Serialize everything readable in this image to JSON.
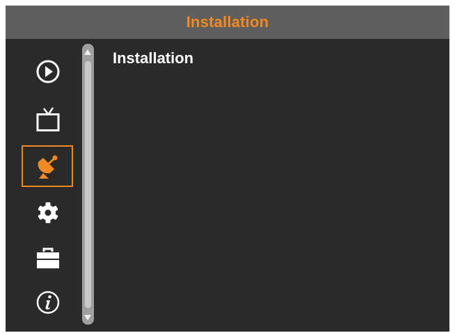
{
  "header": {
    "title": "Installation"
  },
  "content": {
    "title": "Installation"
  },
  "sidebar": {
    "items": [
      {
        "icon": "play-circle-icon",
        "selected": false
      },
      {
        "icon": "tv-icon",
        "selected": false
      },
      {
        "icon": "satellite-dish-icon",
        "selected": true
      },
      {
        "icon": "gear-icon",
        "selected": false
      },
      {
        "icon": "toolbox-icon",
        "selected": false
      },
      {
        "icon": "info-icon",
        "selected": false
      }
    ]
  },
  "colors": {
    "accent": "#f28a24",
    "background": "#2b2a28",
    "titlebar": "#5f5f5e",
    "text": "#ffffff"
  }
}
